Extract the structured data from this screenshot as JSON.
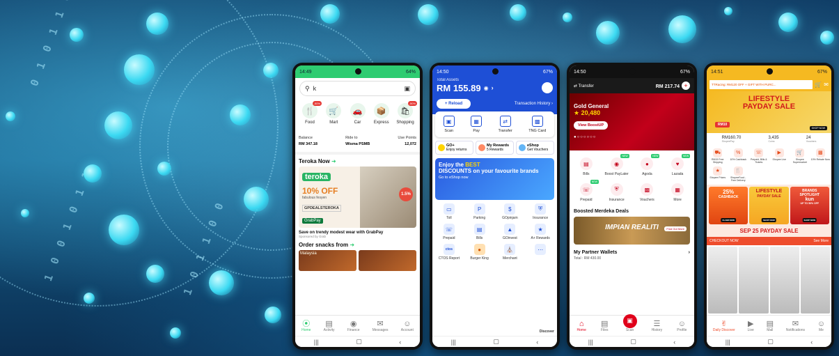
{
  "grab": {
    "status_time": "14:49",
    "status_right": "64%",
    "search_value": "k",
    "categories": [
      {
        "label": "Food",
        "icon": "food-icon",
        "badge": "-50%"
      },
      {
        "label": "Mart",
        "icon": "mart-icon",
        "badge": ""
      },
      {
        "label": "Car",
        "icon": "car-icon",
        "badge": ""
      },
      {
        "label": "Express",
        "icon": "express-icon",
        "badge": ""
      },
      {
        "label": "Shopping",
        "icon": "shopping-icon",
        "badge": "-50%"
      }
    ],
    "balance_label": "Balance",
    "balance_value": "RM 347.18",
    "ride_label": "Ride to",
    "ride_value": "Wisma PSMB",
    "points_label": "Use Points",
    "points_value": "12,072",
    "section_title": "Teroka Now",
    "banner_brand": "teroka",
    "banner_offer": "10% OFF",
    "banner_sub": "fabulous fesyen",
    "banner_code": "GPDEALSTEROKA",
    "banner_pct": "1.5%",
    "banner_pay": "GrabPay",
    "caption": "Save on trendy modest wear with GrabPay",
    "sponsor": "Sponsored by Grab",
    "snacks_title": "Order snacks from",
    "snack_label": "Malaysia",
    "nav": [
      "Home",
      "Activity",
      "Finance",
      "Messages",
      "Account"
    ]
  },
  "tng": {
    "status_time": "14:50",
    "status_right": "67%",
    "total_label": "Total Assets",
    "total_value": "RM 155.89",
    "reload": "+ Reload",
    "history": "Transaction History",
    "quick": [
      "Scan",
      "Pay",
      "Transfer",
      "TNG Card"
    ],
    "chips": [
      {
        "title": "GO+",
        "sub": "Enjoy returns"
      },
      {
        "title": "My Rewards",
        "sub": "5 Rewards"
      },
      {
        "title": "eShop",
        "sub": "Get Vouchers"
      }
    ],
    "banner_line1": "Enjoy the",
    "banner_best": "BEST",
    "banner_line2": "DISCOUNTS on your favourite brands",
    "banner_sub": "Go to eShop now",
    "grid": [
      "Toll",
      "Parking",
      "GOpinjam",
      "Insurance",
      "Prepaid",
      "Bills",
      "GOinvest",
      "A+ Rewards",
      "CTOS Report",
      "Burger King",
      "Merchant",
      ""
    ],
    "grid_icons": [
      "toll-icon",
      "parking-icon",
      "gopinjam-icon",
      "insurance-icon",
      "prepaid-icon",
      "bills-icon",
      "goinvest-icon",
      "rewards-icon",
      "ctos-icon",
      "burger-king-icon",
      "merchant-icon",
      "more-icon"
    ],
    "ctos": "ctos",
    "discover": "Discover"
  },
  "boost": {
    "status_time": "14:50",
    "status_right": "67%",
    "transfer": "Transfer",
    "balance": "RM 217.74",
    "tier": "Gold General",
    "points": "20,480",
    "view_btn": "View BoostUP",
    "grid": [
      "Bills",
      "Boost PayLater",
      "Agoda",
      "Lazada",
      "Prepaid",
      "Insurance",
      "Vouchers",
      "More"
    ],
    "grid_new": [
      false,
      true,
      true,
      true,
      true,
      false,
      false,
      false
    ],
    "new_label": "NEW",
    "section": "Boosted Merdeka Deals",
    "merdeka_text": "IMPIAN REALITI",
    "merdeka_cta": "Find Out More",
    "wallets": "My Partner Wallets",
    "total": "Total : RM 430.00",
    "nav": [
      "Home",
      "Files",
      "Scan",
      "History",
      "Profile"
    ]
  },
  "shopee": {
    "status_time": "14:51",
    "status_right": "67%",
    "search": "TTRacing: RM120 OFF + GIFT WITH PURC...",
    "hero_line1": "LIFESTYLE",
    "hero_line2": "PAYDAY SALE",
    "hero_rm": "RM10",
    "hero_shopnow": "SHOP NOW",
    "wallet": [
      {
        "value": "RM160.70",
        "label": "ShopeePay"
      },
      {
        "value": "3,435",
        "label": "Coins"
      },
      {
        "value": "24",
        "label": "Vouchers"
      }
    ],
    "grid": [
      "RM15 Free Shipping",
      "10% Cashback",
      "Prepaid, Bills & Tickets",
      "Shopee Live",
      "Shopee Supermarket",
      "10% Rebate Now",
      "Shopee Prizes",
      "ShopeeFood - Free Delivery"
    ],
    "promo1_pct": "25%",
    "promo1_word": "CASHBACK",
    "promo1_cta": "CLAIM NOW",
    "promo2_line1": "LIFESTYLE",
    "promo2_line2": "PAYDAY SALE",
    "promo2_cta": "SHOP NOW",
    "promo3_line1": "BRANDS SPOTLIGHT",
    "promo3_brand": "kun",
    "promo3_off": "UP TO 50% OFF",
    "promo3_cta": "SHOP NOW",
    "sep_text": "SEP 25 PAYDAY SALE",
    "checkout": "CHECKOUT NOW",
    "see_more": "See More",
    "nav": [
      "Daily Discover",
      "Live",
      "Mall",
      "Notifications",
      "Me"
    ]
  }
}
